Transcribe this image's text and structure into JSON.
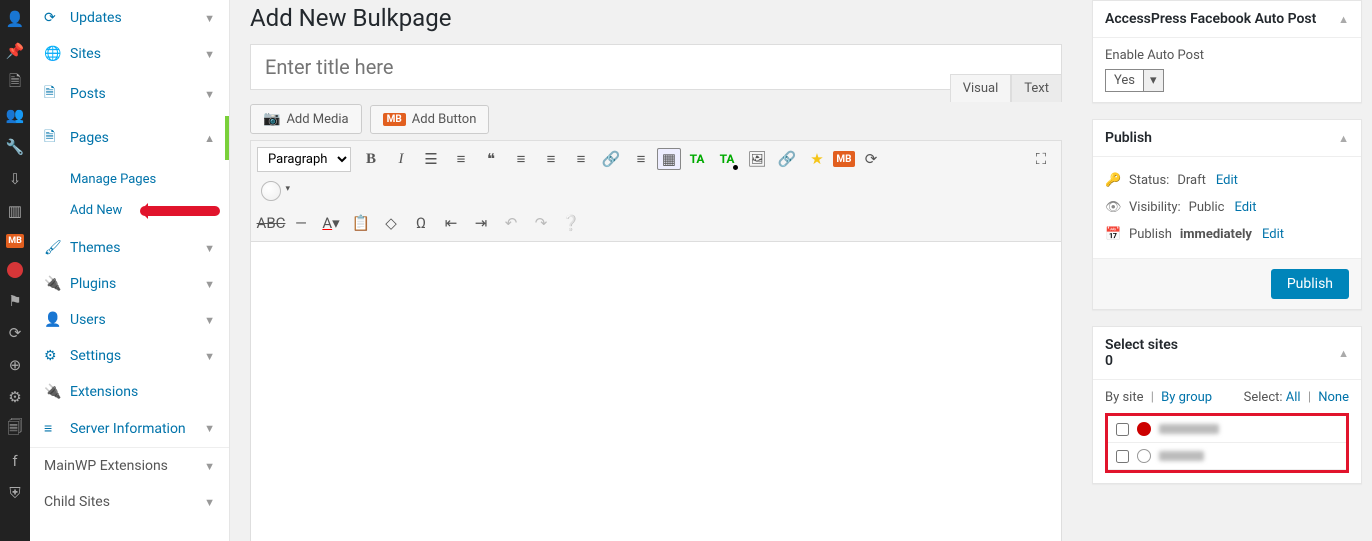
{
  "page_title": "Add New Bulkpage",
  "title_placeholder": "Enter title here",
  "iconstrip": [
    {
      "name": "user-icon"
    },
    {
      "name": "pin-icon"
    },
    {
      "name": "page-icon"
    },
    {
      "name": "person-icon"
    },
    {
      "name": "wrench-icon"
    },
    {
      "name": "download-icon"
    },
    {
      "name": "book-icon"
    },
    {
      "name": "mb-icon"
    },
    {
      "name": "red-dot-icon"
    },
    {
      "name": "flag-icon"
    },
    {
      "name": "cycle-icon"
    },
    {
      "name": "globe-icon"
    },
    {
      "name": "gear-icon"
    },
    {
      "name": "layers-icon"
    },
    {
      "name": "facebook-icon"
    },
    {
      "name": "shield-icon"
    }
  ],
  "sidebar": {
    "items": [
      {
        "icon": "↻",
        "label": "Updates",
        "open": false
      },
      {
        "icon": "🌐",
        "label": "Sites",
        "open": false
      },
      {
        "icon": "📄",
        "label": "Posts",
        "open": false
      },
      {
        "icon": "📄",
        "label": "Pages",
        "open": true,
        "active": true,
        "children": [
          {
            "label": "Manage Pages"
          },
          {
            "label": "Add New",
            "arrow": true
          }
        ]
      },
      {
        "icon": "🖌",
        "label": "Themes",
        "open": false
      },
      {
        "icon": "🔌",
        "label": "Plugins",
        "open": false
      },
      {
        "icon": "👤",
        "label": "Users",
        "open": false
      },
      {
        "icon": "⚙",
        "label": "Settings",
        "open": false
      },
      {
        "icon": "🔌",
        "label": "Extensions",
        "open": false
      },
      {
        "icon": "≡",
        "label": "Server Information",
        "open": false
      },
      {
        "icon": "",
        "label": "MainWP Extensions",
        "open": false
      },
      {
        "icon": "",
        "label": "Child Sites",
        "open": false
      }
    ]
  },
  "media_buttons": {
    "add_media": "Add Media",
    "add_button": "Add Button"
  },
  "editor_tabs": {
    "visual": "Visual",
    "text": "Text"
  },
  "format_select": "Paragraph",
  "panel_fb": {
    "title": "AccessPress Facebook Auto Post",
    "label": "Enable Auto Post",
    "value": "Yes"
  },
  "panel_publish": {
    "title": "Publish",
    "status_label": "Status:",
    "status_value": "Draft",
    "edit": "Edit",
    "visibility_label": "Visibility:",
    "visibility_value": "Public",
    "publish_label": "Publish",
    "publish_value": "immediately",
    "button": "Publish"
  },
  "panel_sites": {
    "title": "Select sites",
    "count": "0",
    "by_site": "By site",
    "by_group": "By group",
    "select": "Select:",
    "all": "All",
    "none": "None",
    "rows": [
      {
        "color": "red",
        "label": "████"
      },
      {
        "color": "gray",
        "label": "███"
      }
    ]
  }
}
